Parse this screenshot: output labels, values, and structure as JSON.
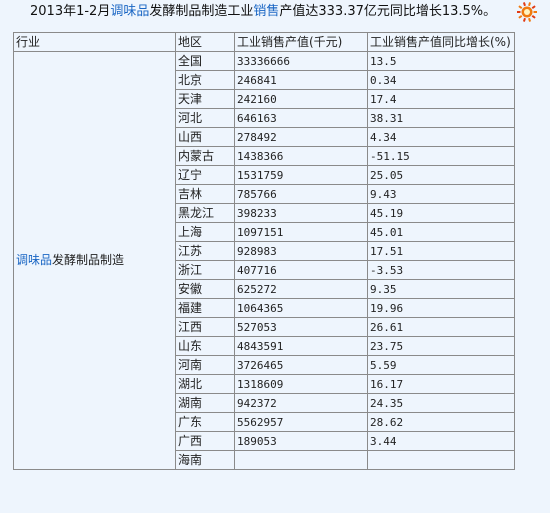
{
  "headline": {
    "prefix": "2013年1-2月",
    "link1": "调味品",
    "middle": "发酵制品制造工业",
    "link2": "销售",
    "suffix": "产值达333.37亿元同比增长13.5%。"
  },
  "logo": {
    "icon": "sun-logo-icon",
    "colors": {
      "sun": "#f07a10",
      "ring": "#e23a12"
    }
  },
  "table": {
    "headers": {
      "industry": "行业",
      "region": "地区",
      "value": "工业销售产值(千元)",
      "growth": "工业销售产值同比增长(%)"
    },
    "industry": {
      "link": "调味品",
      "rest": "发酵制品制造"
    },
    "rows": [
      {
        "region": "全国",
        "value": "33336666",
        "growth": "13.5"
      },
      {
        "region": "北京",
        "value": "246841",
        "growth": "0.34"
      },
      {
        "region": "天津",
        "value": "242160",
        "growth": "17.4"
      },
      {
        "region": "河北",
        "value": "646163",
        "growth": "38.31"
      },
      {
        "region": "山西",
        "value": "278492",
        "growth": "4.34"
      },
      {
        "region": "内蒙古",
        "value": "1438366",
        "growth": "-51.15"
      },
      {
        "region": "辽宁",
        "value": "1531759",
        "growth": "25.05"
      },
      {
        "region": "吉林",
        "value": "785766",
        "growth": "9.43"
      },
      {
        "region": "黑龙江",
        "value": "398233",
        "growth": "45.19"
      },
      {
        "region": "上海",
        "value": "1097151",
        "growth": "45.01"
      },
      {
        "region": "江苏",
        "value": "928983",
        "growth": "17.51"
      },
      {
        "region": "浙江",
        "value": "407716",
        "growth": "-3.53"
      },
      {
        "region": "安徽",
        "value": "625272",
        "growth": "9.35"
      },
      {
        "region": "福建",
        "value": "1064365",
        "growth": "19.96"
      },
      {
        "region": "江西",
        "value": "527053",
        "growth": "26.61"
      },
      {
        "region": "山东",
        "value": "4843591",
        "growth": "23.75"
      },
      {
        "region": "河南",
        "value": "3726465",
        "growth": "5.59"
      },
      {
        "region": "湖北",
        "value": "1318609",
        "growth": "16.17"
      },
      {
        "region": "湖南",
        "value": "942372",
        "growth": "24.35"
      },
      {
        "region": "广东",
        "value": "5562957",
        "growth": "28.62"
      },
      {
        "region": "广西",
        "value": "189053",
        "growth": "3.44"
      },
      {
        "region": "海南",
        "value": "",
        "growth": ""
      }
    ]
  }
}
